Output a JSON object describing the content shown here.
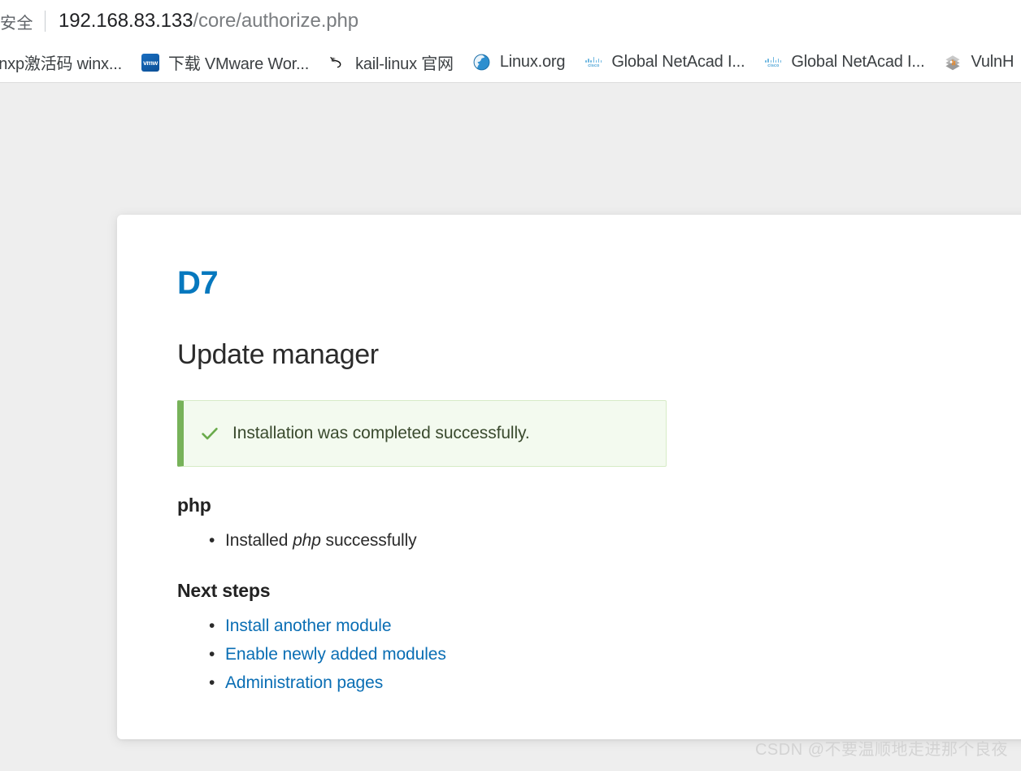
{
  "browser": {
    "omnibox": {
      "security_label": "安全",
      "url_host": "192.168.83.133",
      "url_path": "/core/authorize.php",
      "url_full": "192.168.83.133/core/authorize.php"
    },
    "bookmarks": [
      {
        "label": "inxp激活码 winx...",
        "icon": "none-icon"
      },
      {
        "label": "下载 VMware Wor...",
        "icon": "vmware-icon"
      },
      {
        "label": "kail-linux 官网",
        "icon": "kali-dragon-icon"
      },
      {
        "label": "Linux.org",
        "icon": "globe-icon"
      },
      {
        "label": "Global NetAcad I...",
        "icon": "cisco-icon"
      },
      {
        "label": "Global NetAcad I...",
        "icon": "cisco-icon"
      },
      {
        "label": "VulnH",
        "icon": "vulnhub-icon"
      }
    ]
  },
  "page": {
    "logo": "D7",
    "title": "Update manager",
    "status": {
      "icon": "check-icon",
      "text": "Installation was completed successfully.",
      "accent_color": "#77b259",
      "background_color": "#f3faef"
    },
    "sections": [
      {
        "heading": "php",
        "items": [
          {
            "prefix": "Installed ",
            "emphasis": "php",
            "suffix": " successfully",
            "is_link": false
          }
        ]
      },
      {
        "heading": "Next steps",
        "items": [
          {
            "prefix": "",
            "emphasis": "",
            "suffix": "Install another module",
            "is_link": true
          },
          {
            "prefix": "",
            "emphasis": "",
            "suffix": "Enable newly added modules",
            "is_link": true
          },
          {
            "prefix": "",
            "emphasis": "",
            "suffix": "Administration pages",
            "is_link": true
          }
        ]
      }
    ],
    "link_color": "#0a6eb4",
    "logo_color": "#0678be"
  },
  "watermark": "CSDN @不要温顺地走进那个良夜"
}
